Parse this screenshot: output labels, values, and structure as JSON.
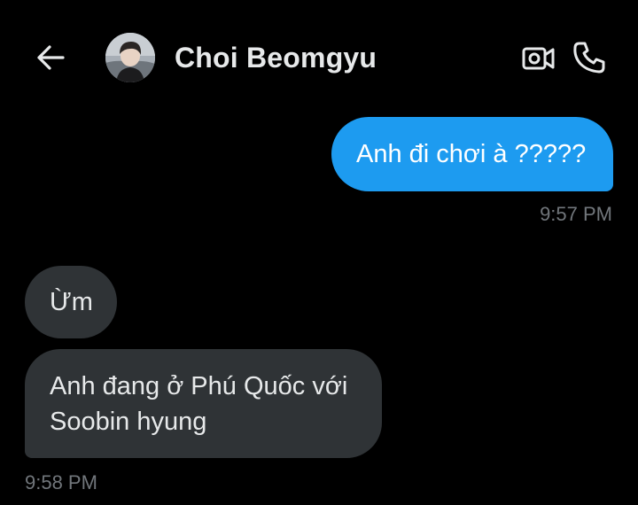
{
  "header": {
    "title": "Choi Beomgyu",
    "icons": {
      "back": "arrow-left-icon",
      "video": "video-camera-icon",
      "call": "phone-icon"
    }
  },
  "messages": [
    {
      "direction": "outgoing",
      "text": "Anh đi chơi à ?????",
      "time": "9:57 PM"
    },
    {
      "direction": "incoming",
      "text": "Ừm"
    },
    {
      "direction": "incoming",
      "text": "Anh đang ở Phú Quốc với Soobin hyung",
      "time": "9:58 PM"
    }
  ],
  "colors": {
    "background": "#000000",
    "outgoing_bubble": "#1d9bf0",
    "incoming_bubble": "#2f3336",
    "text_primary": "#e7e9ea",
    "timestamp": "#71767b"
  }
}
